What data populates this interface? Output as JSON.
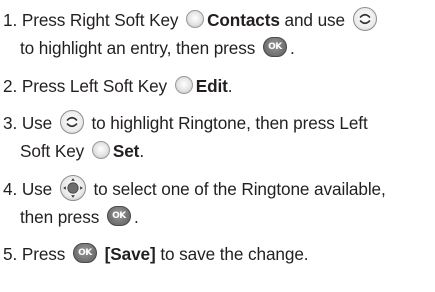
{
  "steps": [
    {
      "num": "1.",
      "t1": "Press Right Soft Key",
      "b1": "Contacts",
      "t2": "and use",
      "t3": "to highlight an entry, then press",
      "t4": "."
    },
    {
      "num": "2.",
      "t1": "Press Left Soft Key",
      "b1": "Edit",
      "t2": "."
    },
    {
      "num": "3.",
      "t1": "Use",
      "t2": "to highlight Ringtone, then press Left",
      "t3": "Soft Key",
      "b1": "Set",
      "t4": "."
    },
    {
      "num": "4.",
      "t1": "Use",
      "t2": "to select one of the Ringtone available,",
      "t3": "then press",
      "t4": "."
    },
    {
      "num": "5.",
      "t1": "Press",
      "b1": "[Save]",
      "t2": "to save the change."
    }
  ],
  "icons": {
    "ok_label": "OK"
  }
}
